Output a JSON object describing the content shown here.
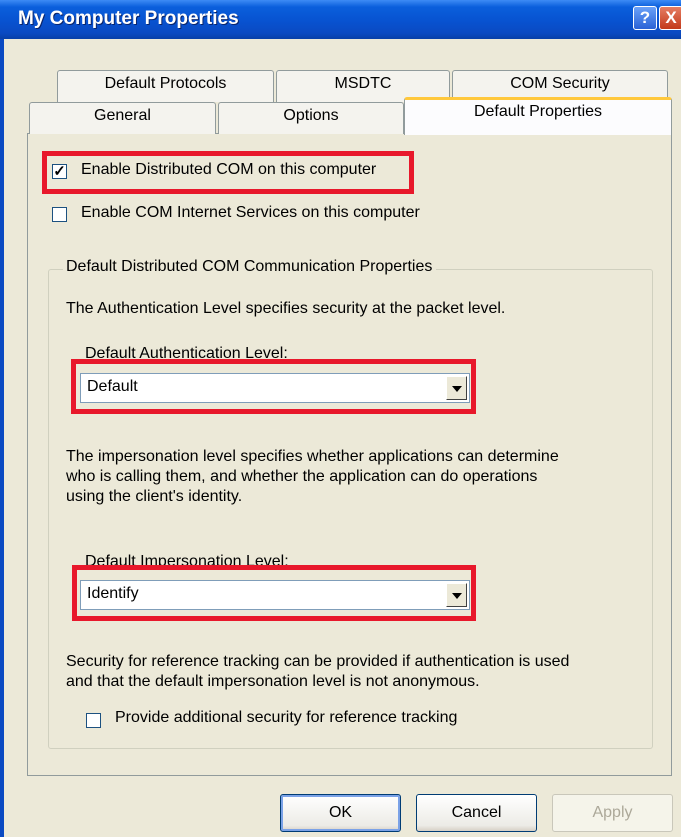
{
  "window": {
    "title": "My Computer Properties",
    "help_glyph": "?",
    "close_glyph": "X",
    "title_color": "#0852d0"
  },
  "tabs": {
    "row1": [
      "Default Protocols",
      "MSDTC",
      "COM Security"
    ],
    "row2": [
      "General",
      "Options",
      "Default Properties"
    ],
    "active": "Default Properties",
    "active_accent": "#ffc83c"
  },
  "settings": {
    "enable_dcom": {
      "label": "Enable Distributed COM on this computer",
      "checked": true,
      "mark": "✓"
    },
    "enable_cis": {
      "label": "Enable COM Internet Services on this computer",
      "checked": false
    }
  },
  "group": {
    "title": "Default Distributed COM Communication Properties",
    "auth_description": "The Authentication Level specifies security at the packet level.",
    "auth_label": "Default Authentication Level:",
    "auth_value": "Default",
    "imp_description": [
      "The impersonation level specifies whether applications can determine",
      "who is calling them, and whether the application can do operations",
      "using the client's identity."
    ],
    "imp_label": "Default Impersonation Level:",
    "imp_value": "Identify",
    "ref_description": [
      "Security for reference tracking can be provided if authentication is used",
      "and that the default impersonation level is not anonymous."
    ],
    "ref_checkbox": {
      "label": "Provide additional security for reference tracking",
      "checked": false
    }
  },
  "buttons": {
    "ok": "OK",
    "cancel": "Cancel",
    "apply": "Apply"
  },
  "highlight_color": "#e8182b"
}
